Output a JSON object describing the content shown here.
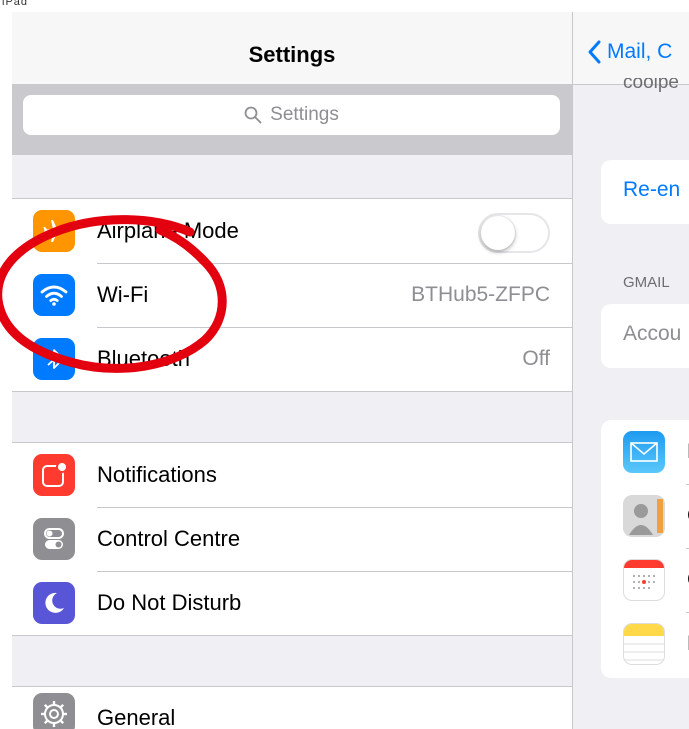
{
  "status_bar": {
    "carrier": "iPad"
  },
  "master": {
    "title": "Settings",
    "search": {
      "placeholder": "Settings"
    },
    "group1": [
      {
        "label": "Airplane Mode",
        "icon": "airplane-icon",
        "color": "#ff9500",
        "toggle": false
      },
      {
        "label": "Wi-Fi",
        "icon": "wifi-icon",
        "color": "#007aff",
        "value": "BTHub5-ZFPC"
      },
      {
        "label": "Bluetooth",
        "icon": "bluetooth-icon",
        "color": "#007aff",
        "value": "Off"
      }
    ],
    "group2": [
      {
        "label": "Notifications",
        "icon": "notifications-icon",
        "color": "#ff3b30"
      },
      {
        "label": "Control Centre",
        "icon": "control-centre-icon",
        "color": "#8e8e93"
      },
      {
        "label": "Do Not Disturb",
        "icon": "moon-icon",
        "color": "#5856d6"
      }
    ],
    "group3": [
      {
        "label": "General",
        "icon": "gear-icon",
        "color": "#8e8e93"
      }
    ]
  },
  "detail": {
    "back_label": "Mail, C",
    "cut_text": "coolpe",
    "reenter_label": "Re-en",
    "section_header": "GMAIL",
    "account_label": "Accou",
    "app_rows": [
      {
        "icon": "mail-icon",
        "label": "M"
      },
      {
        "icon": "contacts-icon",
        "label": "C"
      },
      {
        "icon": "calendar-icon",
        "label": "C"
      },
      {
        "icon": "notes-icon",
        "label": "N"
      }
    ]
  },
  "colors": {
    "accent": "#007aff",
    "annotation": "#e3000f",
    "background": "#efeff4"
  }
}
